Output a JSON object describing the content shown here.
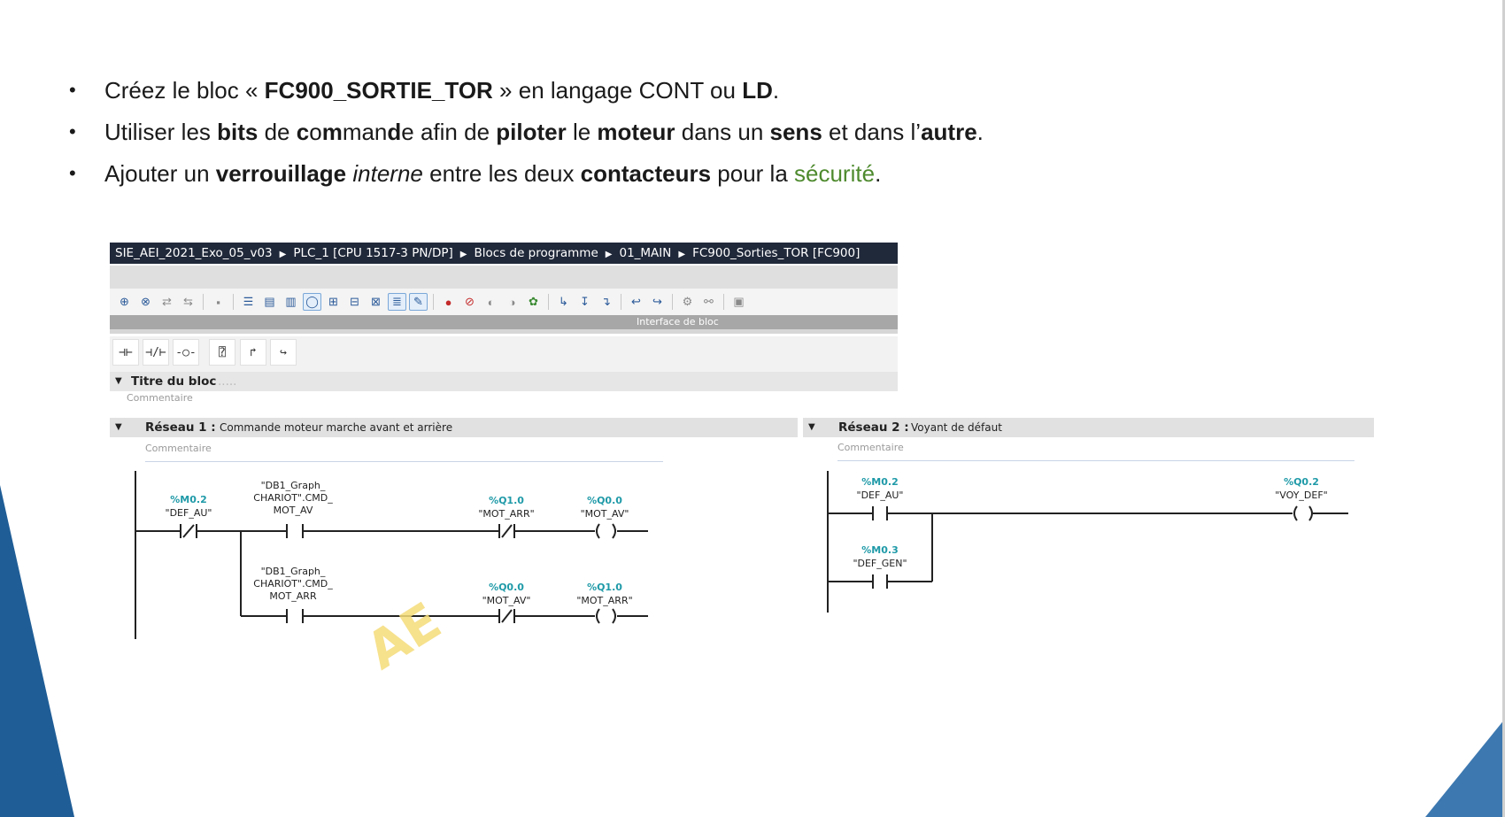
{
  "bullets": {
    "b1": {
      "p1": "Créez le bloc « ",
      "b1": "FC900_SORTIE_TOR",
      "p2": " » en langage CONT ou ",
      "b2": "LD",
      "p3": "."
    },
    "b2": {
      "p1": "Utiliser les ",
      "b1": "bits",
      "p2": " de ",
      "b2a": "c",
      "m1": "o",
      "b2b": "m",
      "m2": "man",
      "b2c": "d",
      "m3": "e",
      "p3": " afin de ",
      "b3": "piloter",
      "p4": " le ",
      "b4": "moteur",
      "p5": " dans un ",
      "b5": "sens",
      "p6": " et dans l’",
      "b6": "autre",
      "p7": "."
    },
    "b3": {
      "p1": "Ajouter un ",
      "b1": "verrouillage",
      "p2": " ",
      "i1": "interne",
      "p3": " entre les deux ",
      "b2": "contacteurs",
      "p4": " pour la ",
      "g1": "sécurité",
      "p5": "."
    }
  },
  "breadcrumb": [
    "SIE_AEI_2021_Exo_05_v03",
    "PLC_1 [CPU 1517-3 PN/DP]",
    "Blocs de programme",
    "01_MAIN",
    "FC900_Sorties_TOR [FC900]"
  ],
  "interface_label": "Interface de bloc",
  "block_title": {
    "label": "Titre du bloc",
    "comment": "Commentaire"
  },
  "network1": {
    "label": "Réseau 1 :",
    "title": "Commande moteur marche avant et arrière",
    "comment": "Commentaire",
    "rung1": {
      "c1_addr": "%M0.2",
      "c1_tag": "\"DEF_AU\"",
      "c2_tag1": "\"DB1_Graph_",
      "c2_tag2": "CHARIOT\".CMD_",
      "c2_tag3": "MOT_AV",
      "c3_addr": "%Q1.0",
      "c3_tag": "\"MOT_ARR\"",
      "coil_addr": "%Q0.0",
      "coil_tag": "\"MOT_AV\""
    },
    "rung2": {
      "c2_tag1": "\"DB1_Graph_",
      "c2_tag2": "CHARIOT\".CMD_",
      "c2_tag3": "MOT_ARR",
      "c3_addr": "%Q0.0",
      "c3_tag": "\"MOT_AV\"",
      "coil_addr": "%Q1.0",
      "coil_tag": "\"MOT_ARR\""
    }
  },
  "network2": {
    "label": "Réseau 2 :",
    "title": "Voyant de défaut",
    "comment": "Commentaire",
    "c1_addr": "%M0.2",
    "c1_tag": "\"DEF_AU\"",
    "c2_addr": "%M0.3",
    "c2_tag": "\"DEF_GEN\"",
    "coil_addr": "%Q0.2",
    "coil_tag": "\"VOY_DEF\""
  },
  "toolbar_icons": [
    "network-insert-icon",
    "network-delete-icon",
    "compile-icon",
    "download-icon",
    "online-icon",
    "show-list-icon",
    "open-all-icon",
    "close-all-icon",
    "comment-icon",
    "absolute-operand-icon",
    "symbol-icon",
    "favorites-icon",
    "display-icon",
    "tags-info-icon",
    "breakpoint-icon",
    "remove-breakpoint-icon",
    "watch-icon",
    "modify-icon",
    "monitor-icon",
    "jump-in-icon",
    "step-icon",
    "step-out-icon",
    "go-to-icon",
    "return-icon",
    "reference-icon",
    "xref-icon",
    "load-icon"
  ],
  "watermark": "AE",
  "colors": {
    "crumb_bg": "#20293a",
    "addr": "#1f9aa8",
    "green": "#4e8a2e",
    "deco_blue": "#1f5d96"
  }
}
